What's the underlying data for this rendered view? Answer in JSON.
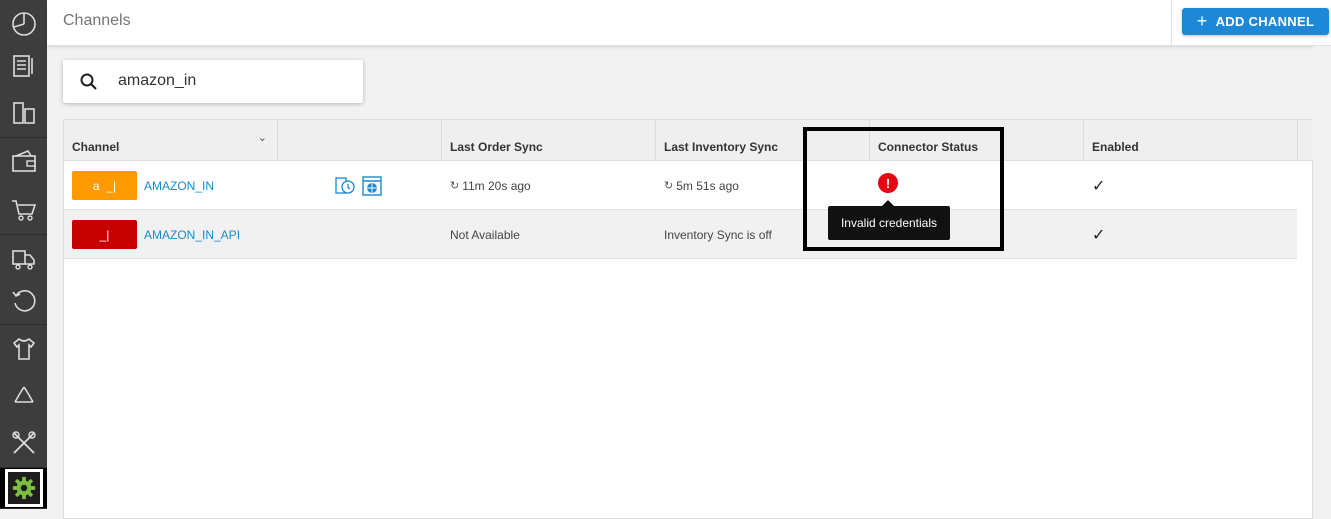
{
  "header": {
    "title": "Channels",
    "add_button_label": "ADD CHANNEL"
  },
  "search": {
    "value": "amazon_in"
  },
  "table": {
    "columns": [
      "Channel",
      "",
      "Last Order Sync",
      "Last Inventory Sync",
      "Connector Status",
      "Enabled"
    ],
    "rows": [
      {
        "channel": "AMAZON_IN",
        "logo_color": "#ff9a00",
        "last_order_sync": "11m 20s ago",
        "last_inventory_sync": "5m 51s ago",
        "connector_status": "error",
        "enabled": true
      },
      {
        "channel": "AMAZON_IN_API",
        "logo_color": "#c60000",
        "last_order_sync": "Not Available",
        "last_inventory_sync": "Inventory Sync is off",
        "connector_status": "",
        "enabled": true
      }
    ]
  },
  "tooltip": {
    "text": "Invalid credentials"
  },
  "sidebar": {
    "items": [
      "dashboard-icon",
      "orders-icon",
      "inventory-icon",
      "wallet-icon",
      "cart-icon",
      "warehouse-icon",
      "returns-icon",
      "products-icon",
      "recycle-icon",
      "tools-icon",
      "settings-icon"
    ]
  },
  "colors": {
    "accent": "#1e88d8",
    "error": "#e30613",
    "link": "#1a8ad0"
  }
}
